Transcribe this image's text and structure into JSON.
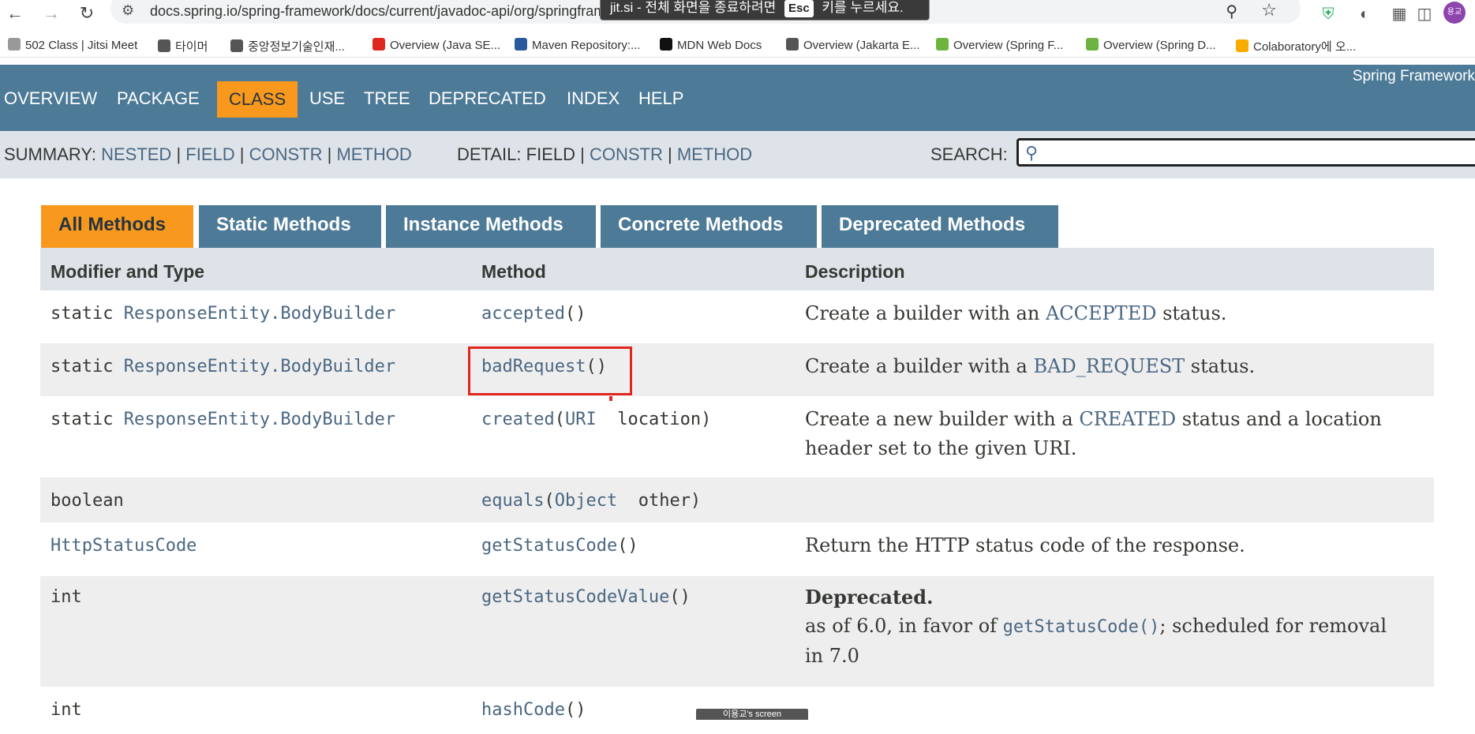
{
  "browser": {
    "url": "docs.spring.io/spring-framework/docs/current/javadoc-api/org/springframework/http/ResponseEntity",
    "toast": {
      "prefix": "jit.si - 전체 화면을 종료하려면",
      "key": "Esc",
      "suffix": "키를 누르세요."
    },
    "profile_initials": "용교",
    "bookmarks": [
      {
        "label": "502 Class | Jitsi Meet",
        "icon": "jitsi-icon",
        "color": "#999999"
      },
      {
        "label": "타이머",
        "icon": "globe-icon",
        "color": "#555555"
      },
      {
        "label": "중앙정보기술인재...",
        "icon": "globe-icon",
        "color": "#555555"
      },
      {
        "label": "Overview (Java SE...",
        "icon": "oracle-icon",
        "color": "#e0271d"
      },
      {
        "label": "Maven Repository:...",
        "icon": "maven-icon",
        "color": "#2a5a9b"
      },
      {
        "label": "MDN Web Docs",
        "icon": "mdn-icon",
        "color": "#111111"
      },
      {
        "label": "Overview (Jakarta E...",
        "icon": "globe-icon",
        "color": "#555555"
      },
      {
        "label": "Overview (Spring F...",
        "icon": "spring-icon",
        "color": "#6db33f"
      },
      {
        "label": "Overview (Spring D...",
        "icon": "spring-icon",
        "color": "#6db33f"
      },
      {
        "label": "Colaboratory에 오...",
        "icon": "colab-icon",
        "color": "#f9ab00"
      }
    ]
  },
  "javadoc": {
    "brand": "Spring Framework",
    "topnav": [
      "OVERVIEW",
      "PACKAGE",
      "CLASS",
      "USE",
      "TREE",
      "DEPRECATED",
      "INDEX",
      "HELP"
    ],
    "active_topnav": "CLASS",
    "subnav": {
      "summary_label": "SUMMARY:",
      "summary_links": [
        "NESTED",
        "FIELD",
        "CONSTR",
        "METHOD"
      ],
      "detail_label": "DETAIL:",
      "detail_plain": "FIELD",
      "detail_links": [
        "CONSTR",
        "METHOD"
      ],
      "separator": "|",
      "search_label": "SEARCH:"
    },
    "tabs": [
      "All Methods",
      "Static Methods",
      "Instance Methods",
      "Concrete Methods",
      "Deprecated Methods"
    ],
    "table_headers": [
      "Modifier and Type",
      "Method",
      "Description"
    ],
    "rows": [
      {
        "mod_prefix": "static ",
        "mod_type": "ResponseEntity.BodyBuilder",
        "method": "accepted",
        "params": "()",
        "desc_pre": "Create a builder with an ",
        "desc_code": "ACCEPTED",
        "desc_post": " status."
      },
      {
        "mod_prefix": "static ",
        "mod_type": "ResponseEntity.BodyBuilder",
        "method": "badRequest",
        "params": "()",
        "desc_pre": "Create a builder with a ",
        "desc_code": "BAD_REQUEST",
        "desc_post": " status."
      },
      {
        "mod_prefix": "static ",
        "mod_type": "ResponseEntity.BodyBuilder",
        "method": "created",
        "params_open": "(",
        "param_type": "URI",
        "param_name": "  location)",
        "desc_pre": "Create a new builder with a ",
        "desc_code": "CREATED",
        "desc_post": " status and a location header set to the given URI."
      },
      {
        "mod_plain": "boolean",
        "method": "equals",
        "params_open": "(",
        "param_type": "Object",
        "param_name": "  other)"
      },
      {
        "mod_type": "HttpStatusCode",
        "method": "getStatusCode",
        "params": "()",
        "desc_pre": "Return the HTTP status code of the response."
      },
      {
        "mod_plain": "int",
        "method": "getStatusCodeValue",
        "params": "()",
        "deprecated": "Deprecated.",
        "desc_pre": "as of 6.0, in favor of ",
        "desc_code": "getStatusCode()",
        "desc_post": "; scheduled for removal in 7.0"
      },
      {
        "mod_plain": "int",
        "method": "hashCode",
        "params": "()"
      }
    ],
    "share_banner": "이용교's screen"
  }
}
